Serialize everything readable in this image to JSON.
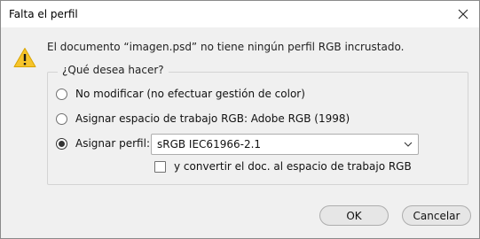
{
  "window": {
    "title": "Falta el perfil",
    "close_icon": "close-icon"
  },
  "message": {
    "icon": "warning-icon",
    "text": "El documento “imagen.psd” no tiene ningún perfil RGB incrustado."
  },
  "options_group": {
    "legend": "¿Qué desea hacer?",
    "options": [
      {
        "label": "No modificar (no efectuar gestión de color)",
        "selected": false
      },
      {
        "label": "Asignar espacio de trabajo RGB: Adobe RGB (1998)",
        "selected": false
      },
      {
        "label": "Asignar perfil:",
        "selected": true
      }
    ],
    "profile_select": {
      "value": "sRGB IEC61966-2.1",
      "icon": "chevron-down-icon"
    },
    "convert_checkbox": {
      "label": "y convertir el doc. al espacio de trabajo RGB",
      "checked": false
    }
  },
  "buttons": {
    "ok": "OK",
    "cancel": "Cancelar"
  }
}
